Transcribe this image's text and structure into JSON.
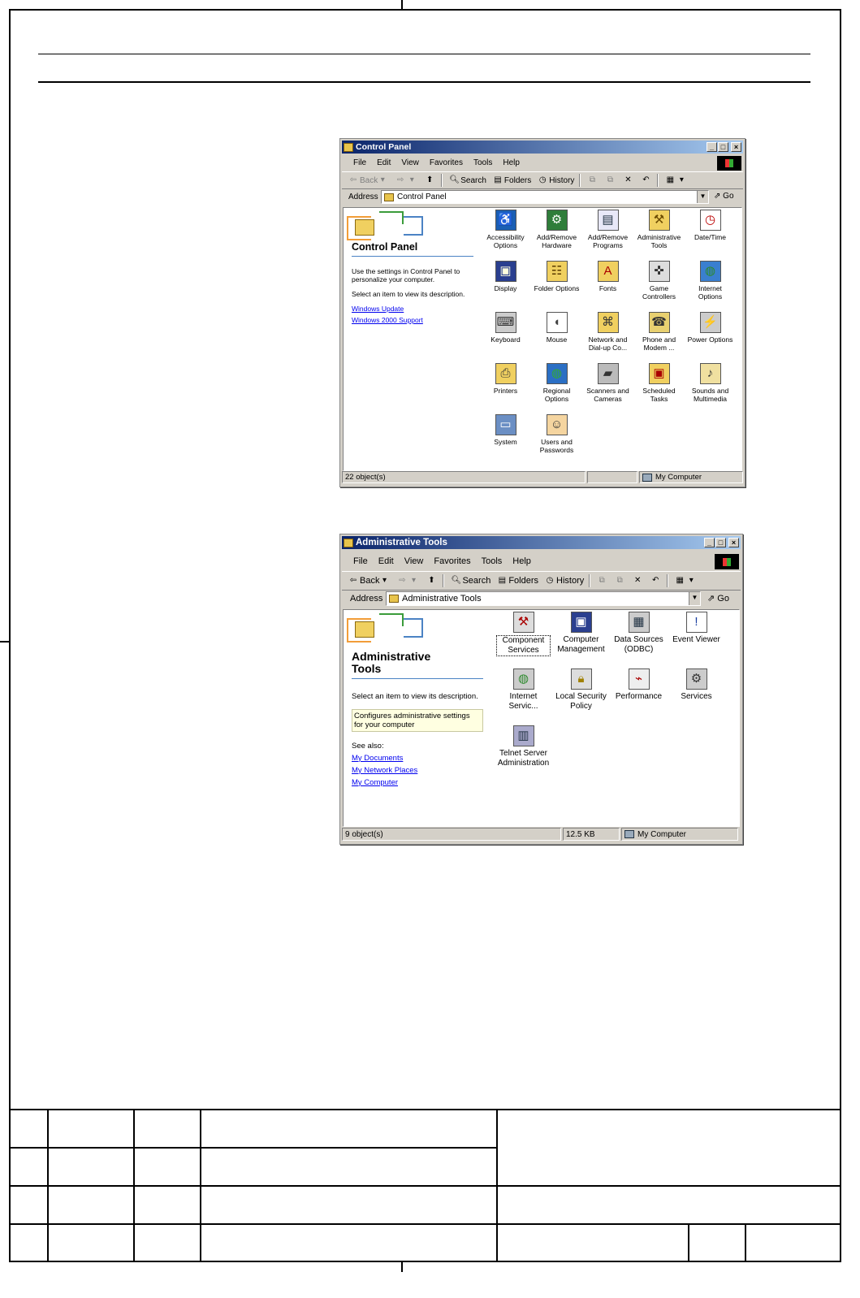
{
  "control_panel": {
    "title": "Control Panel",
    "menu": [
      "File",
      "Edit",
      "View",
      "Favorites",
      "Tools",
      "Help"
    ],
    "toolbar": {
      "back": "Back",
      "search": "Search",
      "folders": "Folders",
      "history": "History"
    },
    "address_label": "Address",
    "address_value": "Control Panel",
    "go_label": "Go",
    "left_title": "Control Panel",
    "left_desc1": "Use the settings in Control Panel to personalize your computer.",
    "left_desc2": "Select an item to view its description.",
    "links": [
      "Windows Update",
      "Windows 2000 Support"
    ],
    "items": [
      {
        "label": "Accessibility Options",
        "icon": "accessibility-icon"
      },
      {
        "label": "Add/Remove Hardware",
        "icon": "hardware-icon"
      },
      {
        "label": "Add/Remove Programs",
        "icon": "programs-icon"
      },
      {
        "label": "Administrative Tools",
        "icon": "admin-tools-icon"
      },
      {
        "label": "Date/Time",
        "icon": "clock-icon"
      },
      {
        "label": "Display",
        "icon": "display-icon"
      },
      {
        "label": "Folder Options",
        "icon": "folder-options-icon"
      },
      {
        "label": "Fonts",
        "icon": "fonts-icon"
      },
      {
        "label": "Game Controllers",
        "icon": "joystick-icon"
      },
      {
        "label": "Internet Options",
        "icon": "globe-icon"
      },
      {
        "label": "Keyboard",
        "icon": "keyboard-icon"
      },
      {
        "label": "Mouse",
        "icon": "mouse-icon"
      },
      {
        "label": "Network and Dial-up Co...",
        "icon": "network-icon"
      },
      {
        "label": "Phone and Modem ...",
        "icon": "phone-icon"
      },
      {
        "label": "Power Options",
        "icon": "power-icon"
      },
      {
        "label": "Printers",
        "icon": "printer-icon"
      },
      {
        "label": "Regional Options",
        "icon": "regional-icon"
      },
      {
        "label": "Scanners and Cameras",
        "icon": "scanner-icon"
      },
      {
        "label": "Scheduled Tasks",
        "icon": "tasks-icon"
      },
      {
        "label": "Sounds and Multimedia",
        "icon": "speaker-icon"
      },
      {
        "label": "System",
        "icon": "computer-icon"
      },
      {
        "label": "Users and Passwords",
        "icon": "users-icon"
      }
    ],
    "status_objects": "22 object(s)",
    "status_zone": "My Computer"
  },
  "admin_tools": {
    "title": "Administrative Tools",
    "menu": [
      "File",
      "Edit",
      "View",
      "Favorites",
      "Tools",
      "Help"
    ],
    "toolbar": {
      "back": "Back",
      "search": "Search",
      "folders": "Folders",
      "history": "History"
    },
    "address_label": "Address",
    "address_value": "Administrative Tools",
    "go_label": "Go",
    "left_title": "Administrative Tools",
    "left_desc": "Select an item to view its description.",
    "tooltip": "Configures administrative settings for your computer",
    "see_also": "See also:",
    "links": [
      "My Documents",
      "My Network Places",
      "My Computer"
    ],
    "items": [
      {
        "label": "Component Services",
        "icon": "component-services-icon"
      },
      {
        "label": "Computer Management",
        "icon": "computer-management-icon"
      },
      {
        "label": "Data Sources (ODBC)",
        "icon": "data-sources-icon"
      },
      {
        "label": "Event Viewer",
        "icon": "event-viewer-icon"
      },
      {
        "label": "Internet Servic...",
        "icon": "internet-services-icon"
      },
      {
        "label": "Local Security Policy",
        "icon": "security-policy-icon"
      },
      {
        "label": "Performance",
        "icon": "performance-icon"
      },
      {
        "label": "Services",
        "icon": "services-icon"
      },
      {
        "label": "Telnet Server Administration",
        "icon": "telnet-icon"
      }
    ],
    "status_objects": "9 object(s)",
    "status_size": "12.5 KB",
    "status_zone": "My Computer"
  }
}
